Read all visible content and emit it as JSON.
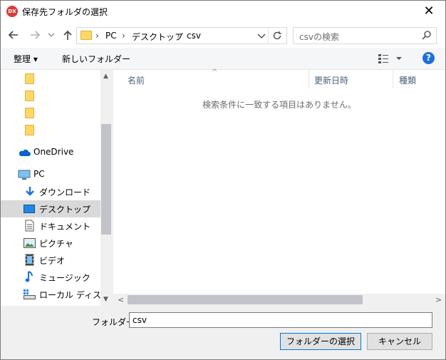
{
  "window": {
    "title": "保存先フォルダの選択",
    "app_icon_text": "DX",
    "close_glyph": "✕"
  },
  "address": {
    "breadcrumb": [
      "PC",
      "デスクトップ",
      "csv"
    ],
    "search_placeholder": "csvの検索"
  },
  "toolbar": {
    "organize_label": "整理 ▾",
    "new_folder_label": "新しいフォルダー",
    "help_glyph": "?"
  },
  "navpane": {
    "items": [
      {
        "label": "",
        "icon": "folder-icon"
      },
      {
        "label": "",
        "icon": "folder-icon"
      },
      {
        "label": "",
        "icon": "folder-icon"
      },
      {
        "label": "",
        "icon": "folder-icon"
      },
      {
        "label": "OneDrive",
        "icon": "onedrive-cloud-icon"
      },
      {
        "label": "PC",
        "icon": "pc-monitor-icon"
      },
      {
        "label": "ダウンロード",
        "icon": "download-arrow-icon"
      },
      {
        "label": "デスクトップ",
        "icon": "desktop-icon",
        "selected": true
      },
      {
        "label": "ドキュメント",
        "icon": "document-icon"
      },
      {
        "label": "ピクチャ",
        "icon": "picture-icon"
      },
      {
        "label": "ビデオ",
        "icon": "video-icon"
      },
      {
        "label": "ミュージック",
        "icon": "music-note-icon"
      },
      {
        "label": "ローカル ディスク (C",
        "icon": "local-disk-icon"
      }
    ]
  },
  "content": {
    "columns": [
      "名前",
      "更新日時",
      "種類"
    ],
    "empty_message": "検索条件に一致する項目はありません。"
  },
  "footer": {
    "folder_label": "フォルダー:",
    "folder_value": "csv",
    "select_button": "フォルダーの選択",
    "cancel_button": "キャンセル"
  },
  "colors": {
    "accent": "#0078d7",
    "folder": "#ffd766",
    "selected_bg": "#d9d9d9",
    "help": "#1e6fd9"
  }
}
